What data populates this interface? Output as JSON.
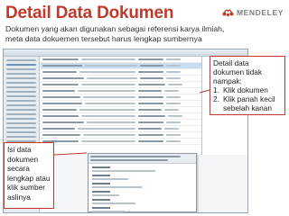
{
  "slide": {
    "title": "Detail Data Dokumen",
    "subtitle": "Dokumen yang akan digunakan sebagai referensi karya ilmiah, meta data dokuemen tersebut harus lengkap sumbernya"
  },
  "logo": {
    "text": "MENDELEY",
    "color": "#c0392b"
  },
  "callouts": {
    "right": {
      "heading": "Detail data dokumen tidak nampak:",
      "steps": [
        {
          "num": "1.",
          "text": "Klik dokumen"
        },
        {
          "num": "2.",
          "text": "Klik panah kecil sebelah kanan"
        }
      ]
    },
    "left": {
      "text": "Isi data dokumen secara lengkap atau klik sumber aslinya"
    }
  },
  "colors": {
    "title": "#c0392b",
    "callout_border": "#c0392b",
    "selected_row": "#c9ddf2"
  }
}
